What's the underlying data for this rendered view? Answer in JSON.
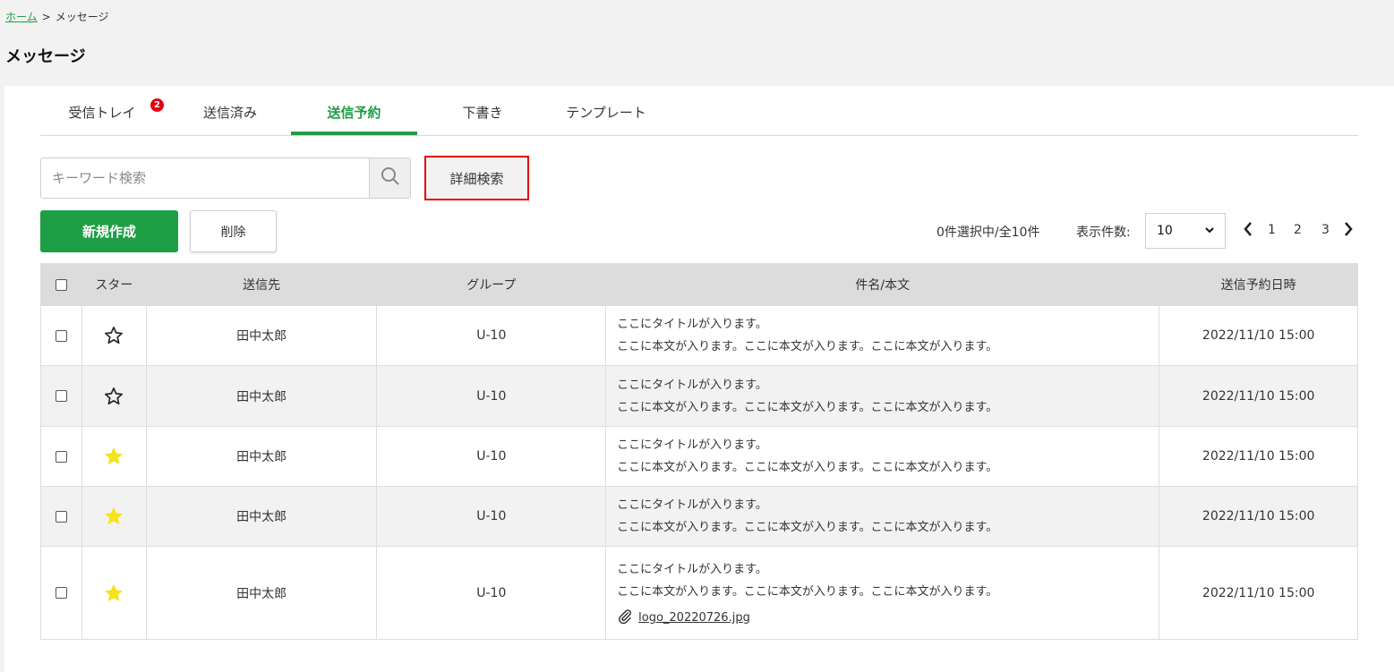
{
  "breadcrumb": {
    "home": "ホーム",
    "separator": ">",
    "current": "メッセージ"
  },
  "page_title": "メッセージ",
  "tabs": [
    {
      "label": "受信トレイ",
      "badge": "2",
      "active": false
    },
    {
      "label": "送信済み",
      "active": false
    },
    {
      "label": "送信予約",
      "active": true
    },
    {
      "label": "下書き",
      "active": false
    },
    {
      "label": "テンプレート",
      "active": false
    }
  ],
  "search": {
    "placeholder": "キーワード検索",
    "advanced_label": "詳細検索",
    "icon": "search-icon"
  },
  "actions": {
    "new_label": "新規作成",
    "delete_label": "削除"
  },
  "list_status": {
    "selection": "0件選択中/全10件",
    "per_page_label": "表示件数:",
    "per_page_value": "10",
    "pages": [
      "1",
      "2",
      "3"
    ]
  },
  "table": {
    "headers": {
      "star": "スター",
      "to": "送信先",
      "group": "グループ",
      "subject": "件名/本文",
      "scheduled": "送信予約日時"
    },
    "rows": [
      {
        "starred": false,
        "to": "田中太郎",
        "group": "U-10",
        "title": "ここにタイトルが入ります。",
        "body": "ここに本文が入ります。ここに本文が入ります。ここに本文が入ります。",
        "date": "2022/11/10 15:00"
      },
      {
        "starred": false,
        "to": "田中太郎",
        "group": "U-10",
        "title": "ここにタイトルが入ります。",
        "body": "ここに本文が入ります。ここに本文が入ります。ここに本文が入ります。",
        "date": "2022/11/10 15:00"
      },
      {
        "starred": true,
        "to": "田中太郎",
        "group": "U-10",
        "title": "ここにタイトルが入ります。",
        "body": "ここに本文が入ります。ここに本文が入ります。ここに本文が入ります。",
        "date": "2022/11/10 15:00"
      },
      {
        "starred": true,
        "to": "田中太郎",
        "group": "U-10",
        "title": "ここにタイトルが入ります。",
        "body": "ここに本文が入ります。ここに本文が入ります。ここに本文が入ります。",
        "date": "2022/11/10 15:00"
      },
      {
        "starred": true,
        "to": "田中太郎",
        "group": "U-10",
        "title": "ここにタイトルが入ります。",
        "body": "ここに本文が入ります。ここに本文が入ります。ここに本文が入ります。",
        "date": "2022/11/10 15:00",
        "attachment": "logo_20220726.jpg"
      }
    ]
  },
  "colors": {
    "accent": "#1e9e45",
    "badge": "#e60012",
    "star_filled": "#f5e31b",
    "highlight_border": "#e60012"
  }
}
